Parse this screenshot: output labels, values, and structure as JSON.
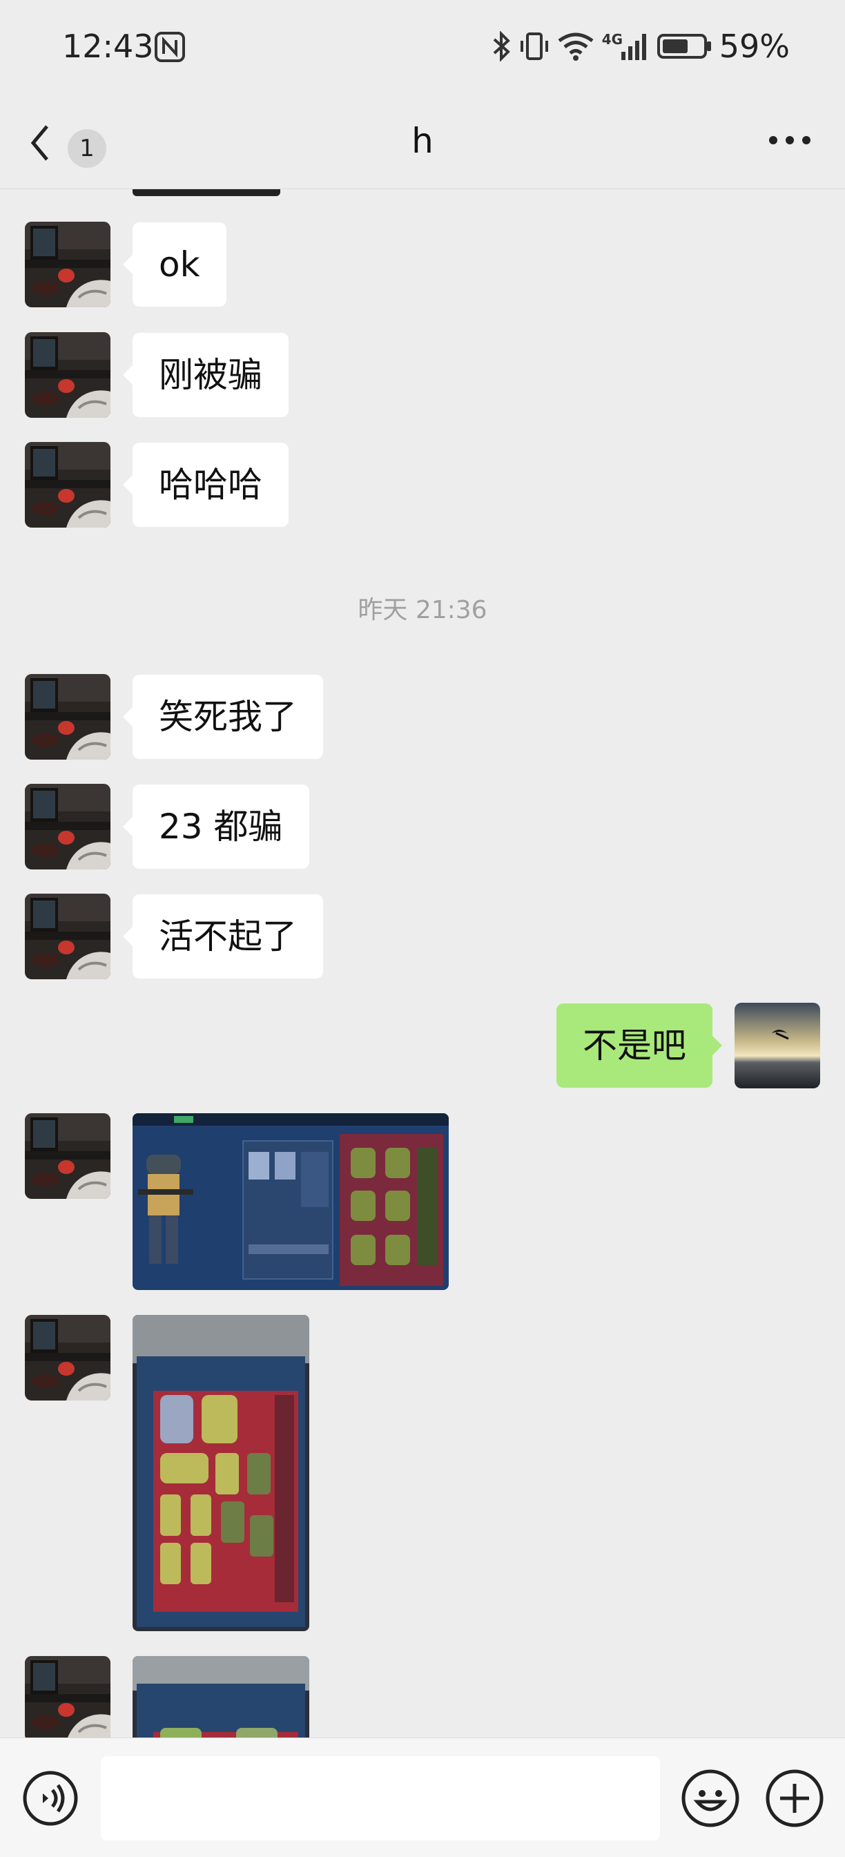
{
  "status_bar": {
    "time": "12:43",
    "network": "4G",
    "battery_pct": "59%"
  },
  "header": {
    "unread_count": "1",
    "title": "h",
    "back_icon": "chevron-left-icon",
    "more_icon": "more-dots-icon"
  },
  "messages": {
    "m1": "ok",
    "m2": "刚被骗",
    "m3": "哈哈哈",
    "timestamp": "昨天 21:36",
    "m4": "笑死我了",
    "m5": "23 都骗",
    "m6": "活不起了",
    "m7_out": "不是吧"
  },
  "input_bar": {
    "placeholder": "",
    "voice_icon": "voice-icon",
    "emoji_icon": "emoji-icon",
    "plus_icon": "plus-icon"
  },
  "colors": {
    "background": "#ededed",
    "bubble_in": "#ffffff",
    "bubble_out": "#a9e97c",
    "timestamp": "#a0a0a0"
  }
}
